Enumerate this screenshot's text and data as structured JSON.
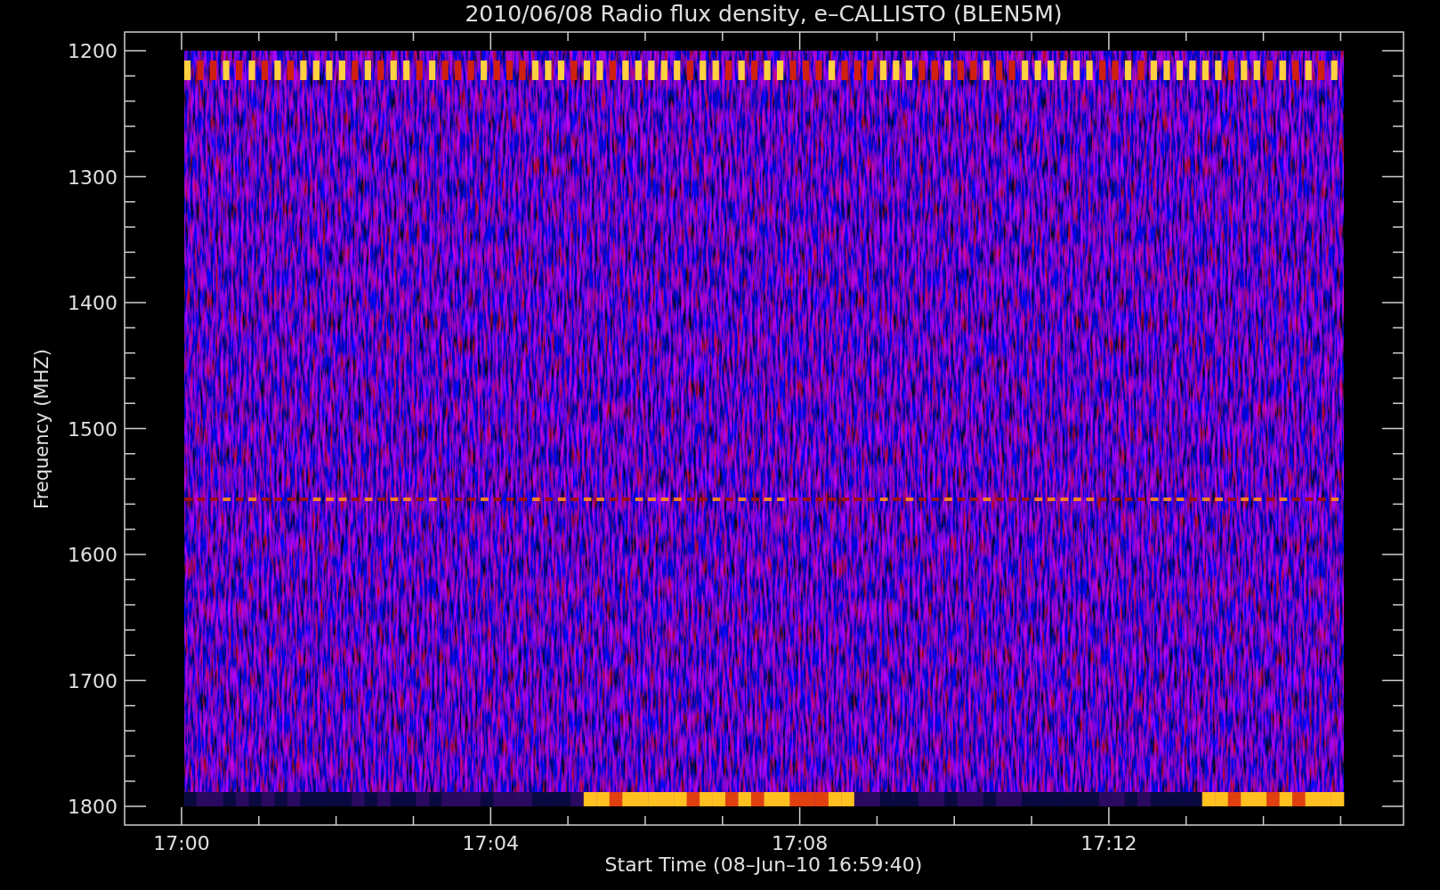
{
  "title": "2010/06/08  Radio flux density, e–CALLISTO (BLEN5M)",
  "y_axis": {
    "label": "Frequency (MHZ)",
    "ticks": [
      "1200",
      "1300",
      "1400",
      "1500",
      "1600",
      "1700",
      "1800"
    ]
  },
  "x_axis": {
    "label": "Start Time (08–Jun–10 16:59:40)",
    "ticks": [
      "17:00",
      "17:04",
      "17:08",
      "17:12"
    ]
  }
}
